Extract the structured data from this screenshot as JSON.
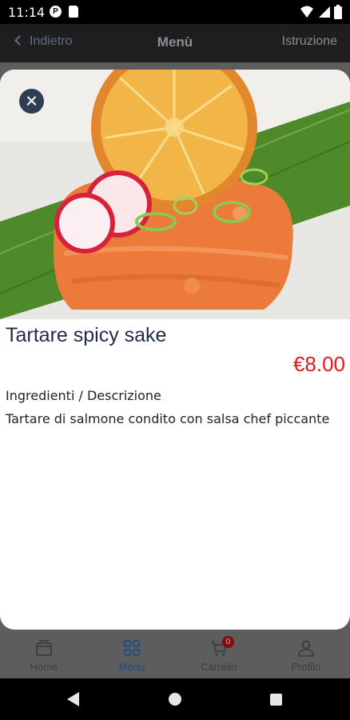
{
  "status_bar": {
    "time": "11:14"
  },
  "app_bar": {
    "back_label": "Indietro",
    "title": "Menù",
    "right_label": "Istruzione"
  },
  "dish": {
    "name": "Tartare spicy sake",
    "price": "€8.00",
    "description_label": "Ingredienti / Descrizione",
    "description": "Tartare di salmone condito con salsa chef piccante"
  },
  "bottom_nav": {
    "items": [
      {
        "label": "Home",
        "icon": "store-icon"
      },
      {
        "label": "Menù",
        "icon": "grid-icon"
      },
      {
        "label": "Carrello",
        "icon": "cart-icon",
        "badge": "0"
      },
      {
        "label": "Profilo",
        "icon": "user-icon"
      }
    ],
    "active_index": 1
  },
  "colors": {
    "price": "#e2191c",
    "title": "#1f2b47",
    "close_button": "#2f3e55",
    "active_nav": "#1f4a86"
  }
}
